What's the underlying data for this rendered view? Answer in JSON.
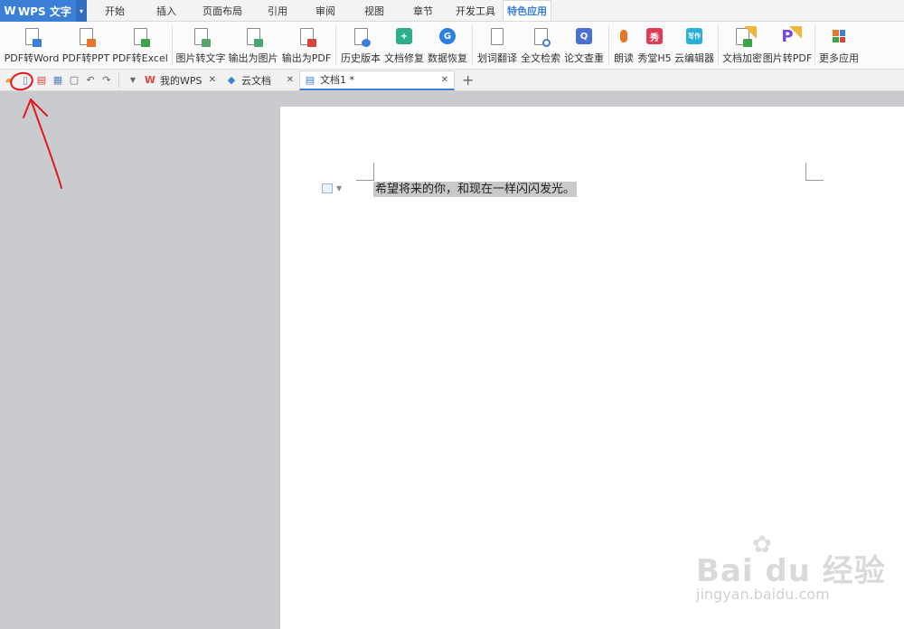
{
  "app": {
    "title": "WPS 文字"
  },
  "menu": [
    {
      "label": "开始",
      "active": false
    },
    {
      "label": "插入",
      "active": false
    },
    {
      "label": "页面布局",
      "active": false
    },
    {
      "label": "引用",
      "active": false
    },
    {
      "label": "审阅",
      "active": false
    },
    {
      "label": "视图",
      "active": false
    },
    {
      "label": "章节",
      "active": false
    },
    {
      "label": "开发工具",
      "active": false
    },
    {
      "label": "特色应用",
      "active": true
    }
  ],
  "ribbon": {
    "pdf_to_word": "PDF转Word",
    "pdf_to_ppt": "PDF转PPT",
    "pdf_to_excel": "PDF转Excel",
    "image_to_text": "图片转文字",
    "export_image": "输出为图片",
    "export_pdf": "输出为PDF",
    "history": "历史版本",
    "repair": "文档修复",
    "recover": "数据恢复",
    "translate": "划词翻译",
    "fulltext": "全文检索",
    "check": "论文查重",
    "read": "朗读",
    "h5": "秀堂H5",
    "cloud_editor": "云编辑器",
    "encrypt": "文档加密",
    "img_to_pdf": "图片转PDF",
    "more": "更多应用",
    "xiu_icon_text": "秀",
    "yun_icon_text": "写作"
  },
  "tabs": {
    "my_wps": "我的WPS",
    "cloud_docs": "云文档",
    "doc1": "文档1 *"
  },
  "document": {
    "text": "希望将来的你，和现在一样闪闪发光。"
  },
  "watermark": {
    "big": "Bai du 经验",
    "small": "jingyan.baidu.com"
  },
  "colors": {
    "accent": "#3c7fd6",
    "annotation": "#e0191d"
  }
}
